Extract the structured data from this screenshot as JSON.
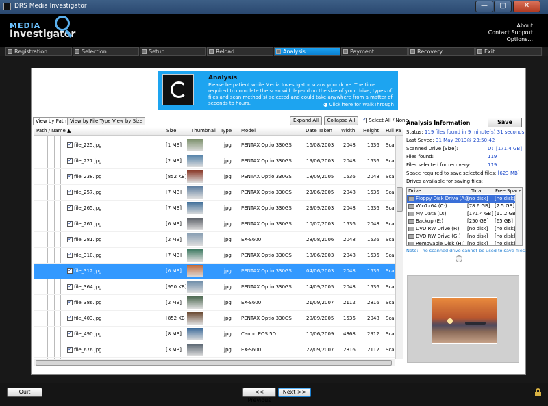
{
  "window": {
    "title": "DRS Media Investigator",
    "min_label": "—",
    "max_label": "▢",
    "close_label": "✕"
  },
  "logo": {
    "line1": "MEDIA",
    "line2": "Investigator"
  },
  "toplinks": [
    "About",
    "Contact Support",
    "Options..."
  ],
  "nav": [
    {
      "label": "Registration",
      "active": false
    },
    {
      "label": "Selection",
      "active": false
    },
    {
      "label": "Setup",
      "active": false
    },
    {
      "label": "Reload",
      "active": false
    },
    {
      "label": "Analysis",
      "active": true
    },
    {
      "label": "Payment",
      "active": false
    },
    {
      "label": "Recovery",
      "active": false
    },
    {
      "label": "Exit",
      "active": false
    }
  ],
  "banner": {
    "title": "Analysis",
    "description": "Please be patient while Media Investigator scans your drive. The time required to complete the scan will depend on the size of your drive, types of files and scan method(s) selected and could take anywhere from a matter of seconds to hours.",
    "link": "Click here for WalkThrough"
  },
  "view_tabs": [
    "View by Path",
    "View by File Type",
    "View by Size"
  ],
  "toolbar": {
    "expand_all": "Expand All",
    "collapse_all": "Collapse All",
    "select_all": "Select All / None"
  },
  "columns": [
    "Path / Name",
    "Size",
    "Thumbnail",
    "Type",
    "Model",
    "Date Taken",
    "Width",
    "Height",
    "Full Pa"
  ],
  "rows": [
    {
      "name": "file_225.jpg",
      "size": "[1 MB]",
      "type": "jpg",
      "model": "PENTAX Optio 330GS",
      "date": "16/08/2003",
      "width": "2048",
      "height": "1536",
      "full": "Scan",
      "selected": false,
      "thumb": "#7a8f6a"
    },
    {
      "name": "file_227.jpg",
      "size": "[2 MB]",
      "type": "jpg",
      "model": "PENTAX Optio 330GS",
      "date": "19/06/2003",
      "width": "2048",
      "height": "1536",
      "full": "Scan",
      "selected": false,
      "thumb": "#4f7fa8"
    },
    {
      "name": "file_238.jpg",
      "size": "[852 KB]",
      "type": "jpg",
      "model": "PENTAX Optio 330GS",
      "date": "18/09/2005",
      "width": "1536",
      "height": "2048",
      "full": "Scan",
      "selected": false,
      "thumb": "#8a3a2a"
    },
    {
      "name": "file_257.jpg",
      "size": "[7 MB]",
      "type": "jpg",
      "model": "PENTAX Optio 330GS",
      "date": "23/06/2005",
      "width": "2048",
      "height": "1536",
      "full": "Scan",
      "selected": false,
      "thumb": "#5c7da0"
    },
    {
      "name": "file_265.jpg",
      "size": "[7 MB]",
      "type": "jpg",
      "model": "PENTAX Optio 330GS",
      "date": "29/09/2003",
      "width": "2048",
      "height": "1536",
      "full": "Scan",
      "selected": false,
      "thumb": "#3f6f9a"
    },
    {
      "name": "file_267.jpg",
      "size": "[6 MB]",
      "type": "jpg",
      "model": "PENTAX Optio 330GS",
      "date": "10/07/2003",
      "width": "1536",
      "height": "2048",
      "full": "Scan",
      "selected": false,
      "thumb": "#5a5f66"
    },
    {
      "name": "file_281.jpg",
      "size": "[2 MB]",
      "type": "jpg",
      "model": "EX-S600",
      "date": "28/08/2006",
      "width": "2048",
      "height": "1536",
      "full": "Scan",
      "selected": false,
      "thumb": "#8aa0b4"
    },
    {
      "name": "file_310.jpg",
      "size": "[7 MB]",
      "type": "jpg",
      "model": "PENTAX Optio 330GS",
      "date": "18/06/2003",
      "width": "2048",
      "height": "1536",
      "full": "Scan",
      "selected": false,
      "thumb": "#3e7a62"
    },
    {
      "name": "file_312.jpg",
      "size": "[6 MB]",
      "type": "jpg",
      "model": "PENTAX Optio 330GS",
      "date": "04/06/2003",
      "width": "2048",
      "height": "1536",
      "full": "Scan",
      "selected": true,
      "thumb": "#c26a3a"
    },
    {
      "name": "file_364.jpg",
      "size": "[950 KB]",
      "type": "jpg",
      "model": "PENTAX Optio 330GS",
      "date": "14/09/2005",
      "width": "2048",
      "height": "1536",
      "full": "Scan",
      "selected": false,
      "thumb": "#6a8aa8"
    },
    {
      "name": "file_386.jpg",
      "size": "[2 MB]",
      "type": "jpg",
      "model": "EX-S600",
      "date": "21/09/2007",
      "width": "2112",
      "height": "2816",
      "full": "Scan",
      "selected": false,
      "thumb": "#4e6a52"
    },
    {
      "name": "file_403.jpg",
      "size": "[852 KB]",
      "type": "jpg",
      "model": "PENTAX Optio 330GS",
      "date": "20/09/2005",
      "width": "1536",
      "height": "2048",
      "full": "Scan",
      "selected": false,
      "thumb": "#6b4a32"
    },
    {
      "name": "file_490.jpg",
      "size": "[8 MB]",
      "type": "jpg",
      "model": "Canon EOS 5D",
      "date": "10/06/2009",
      "width": "4368",
      "height": "2912",
      "full": "Scan",
      "selected": false,
      "thumb": "#3a6a9a"
    },
    {
      "name": "file_676.jpg",
      "size": "[3 MB]",
      "type": "jpg",
      "model": "EX-S600",
      "date": "22/09/2007",
      "width": "2816",
      "height": "2112",
      "full": "Scan",
      "selected": false,
      "thumb": "#56626e"
    }
  ],
  "info": {
    "title": "Analysis Information",
    "save": "Save",
    "status_label": "Status:",
    "status_value": "119 files found in 9 minute(s) 31 seconds",
    "last_saved_label": "Last Saved:",
    "last_saved_value": "31 May 2013@ 23:50:42",
    "scanned_label": "Scanned Drive [Size]:",
    "scanned_drive": "D:",
    "scanned_size": "[171.4 GB]",
    "files_found_label": "Files found:",
    "files_found_value": "119",
    "files_selected_label": "Files selected for recovery:",
    "files_selected_value": "119",
    "space_label": "Space required to save selected files:",
    "space_value": "[623 MB]",
    "drives_label": "Drives available for saving files:",
    "drive_cols": [
      "Drive",
      "Total",
      "Free Space"
    ],
    "drives": [
      {
        "name": "Floppy Disk Drive (A:)",
        "total": "[no disk]",
        "free": "[no disk]",
        "selected": true
      },
      {
        "name": "Win7x64 (C:)",
        "total": "[78.6 GB]",
        "free": "[2.5 GB]",
        "selected": false
      },
      {
        "name": "My Data (D:)",
        "total": "[171.4 GB]",
        "free": "[11.2 GB]",
        "selected": false
      },
      {
        "name": "Backup (E:)",
        "total": "[250 GB]",
        "free": "[65 GB]",
        "selected": false
      },
      {
        "name": "DVD RW Drive (F:)",
        "total": "[no disk]",
        "free": "[no disk]",
        "selected": false
      },
      {
        "name": "DVD RW Drive (G:)",
        "total": "[no disk]",
        "free": "[no disk]",
        "selected": false
      },
      {
        "name": "Removable Disk (H:)",
        "total": "[no disk]",
        "free": "[no disk]",
        "selected": false
      }
    ],
    "note": "Note: The scanned drive cannot be used to save files."
  },
  "footer": {
    "quit": "Quit",
    "previous": "<< Previous",
    "next": "Next >>"
  }
}
